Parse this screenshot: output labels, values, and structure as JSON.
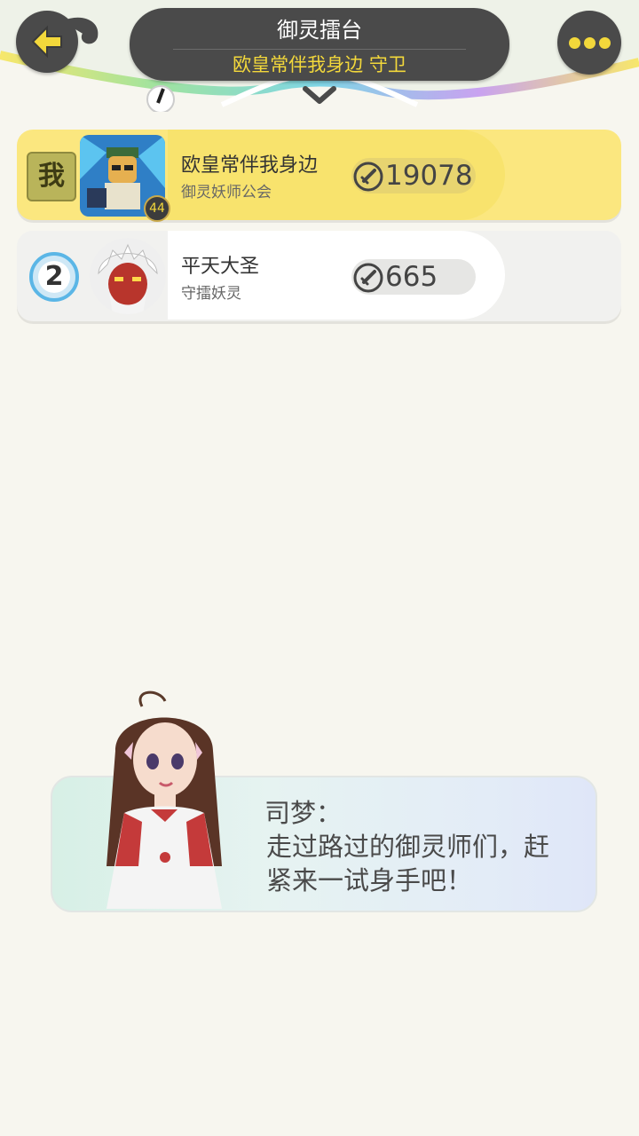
{
  "header": {
    "title": "御灵擂台",
    "subtitle": "欧皇常伴我身边 守卫",
    "back_icon": "back-arrow-icon",
    "more_icon": "more-dots-icon",
    "expand_icon": "chevron-down-icon"
  },
  "colors": {
    "accent_yellow": "#f3d83b",
    "header_dark": "#4a4a4a",
    "self_row": "#fbe77f",
    "background": "#f7f6ef"
  },
  "rankings": [
    {
      "rank_label": "我",
      "name": "欧皇常伴我身边",
      "guild": "御灵妖师公会",
      "level": "44",
      "score": "19078",
      "score_icon": "sword-icon"
    },
    {
      "rank_label": "2",
      "name": "平天大圣",
      "guild": "守擂妖灵",
      "score": "665",
      "score_icon": "sword-icon"
    }
  ],
  "npc": {
    "speaker": "司梦：",
    "line1": "走过路过的御灵师们，赶",
    "line2": "紧来一试身手吧！"
  }
}
